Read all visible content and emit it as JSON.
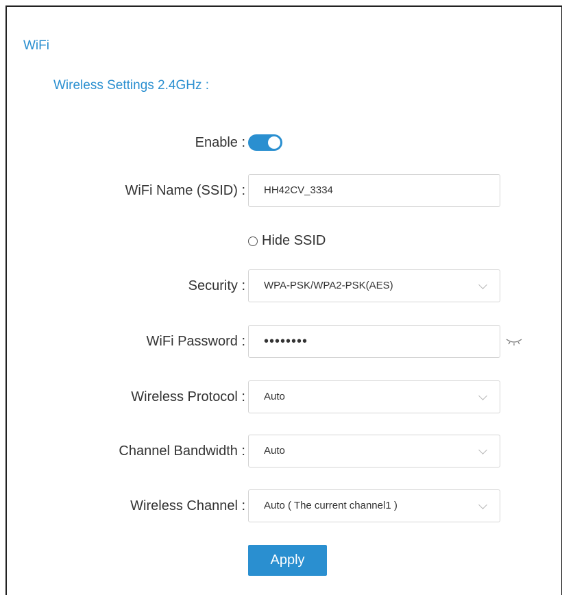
{
  "page": {
    "section_title": "WiFi",
    "subsection_title": "Wireless Settings 2.4GHz :"
  },
  "form": {
    "enable": {
      "label": "Enable :",
      "checked": true
    },
    "ssid": {
      "label": "WiFi Name (SSID) :",
      "value": "HH42CV_3334"
    },
    "hide_ssid": {
      "label": "Hide SSID",
      "checked": false
    },
    "security": {
      "label": "Security :",
      "value": "WPA-PSK/WPA2-PSK(AES)"
    },
    "password": {
      "label": "WiFi Password :",
      "value": "••••••••",
      "reveal_icon": "eye-closed-icon"
    },
    "protocol": {
      "label": "Wireless Protocol :",
      "value": "Auto"
    },
    "bandwidth": {
      "label": "Channel Bandwidth :",
      "value": "Auto"
    },
    "channel": {
      "label": "Wireless Channel :",
      "value": "Auto ( The current channel1 )"
    },
    "apply_label": "Apply"
  },
  "colors": {
    "accent": "#2a8fd0",
    "text": "#333333",
    "border": "#d4d4d4"
  }
}
